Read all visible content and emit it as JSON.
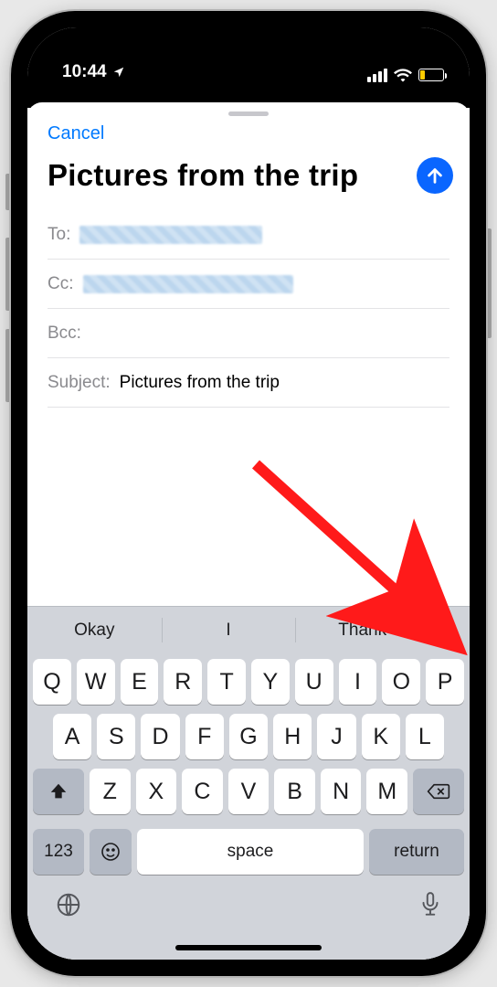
{
  "status": {
    "time": "10:44",
    "location_icon": "location-arrow"
  },
  "nav": {
    "cancel": "Cancel"
  },
  "compose": {
    "title": "Pictures from the trip",
    "fields": {
      "to_label": "To:",
      "cc_label": "Cc:",
      "bcc_label": "Bcc:",
      "subject_label": "Subject:",
      "subject_value": "Pictures from the trip"
    }
  },
  "keyboard": {
    "suggestions": [
      "Okay",
      "I",
      "Thank"
    ],
    "row1": [
      "Q",
      "W",
      "E",
      "R",
      "T",
      "Y",
      "U",
      "I",
      "O",
      "P"
    ],
    "row2": [
      "A",
      "S",
      "D",
      "F",
      "G",
      "H",
      "J",
      "K",
      "L"
    ],
    "row3": [
      "Z",
      "X",
      "C",
      "V",
      "B",
      "N",
      "M"
    ],
    "ctrl": {
      "num": "123",
      "space": "space",
      "ret": "return"
    }
  },
  "colors": {
    "accent": "#007aff",
    "send": "#0a66ff",
    "arrow": "#ff1a1a"
  }
}
